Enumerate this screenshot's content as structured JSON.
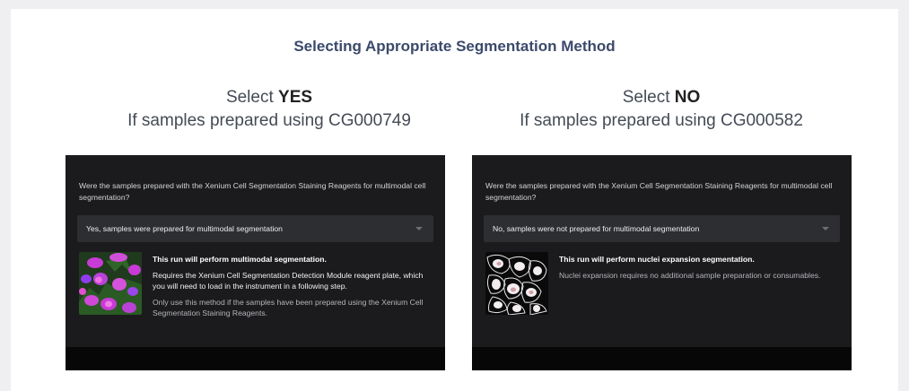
{
  "page": {
    "title": "Selecting Appropriate Segmentation Method"
  },
  "left": {
    "heading_prefix": "Select ",
    "heading_choice": "YES",
    "heading_sub": "If samples prepared using CG000749",
    "question": "Were the samples prepared with the Xenium Cell Segmentation Staining Reagents for multimodal cell segmentation?",
    "select_value": "Yes, samples were prepared for multimodal segmentation",
    "info_title": "This run will perform multimodal segmentation.",
    "info_line1": "Requires the Xenium Cell Segmentation Detection Module reagent plate, which you will need to load in the instrument in a following step.",
    "info_line2": "Only use this method if the samples have been prepared using the Xenium Cell Segmentation Staining Reagents."
  },
  "right": {
    "heading_prefix": "Select ",
    "heading_choice": "NO",
    "heading_sub": "If samples prepared using CG000582",
    "question": "Were the samples prepared with the Xenium Cell Segmentation Staining Reagents for multimodal cell segmentation?",
    "select_value": "No, samples were not prepared for multimodal segmentation",
    "info_title": "This run will perform nuclei expansion segmentation.",
    "info_line1": "Nuclei expansion requires no additional sample preparation or consumables."
  },
  "colors": {
    "title": "#3b4a6b",
    "panel_bg": "#1b1b1d",
    "select_bg": "#2d2e31",
    "multimodal_cells": "#c83bd6",
    "nuclei_cells": "#ffffff"
  },
  "icons": {
    "dropdown": "chevron-down-icon",
    "left_thumb": "multimodal-cells-image",
    "right_thumb": "nuclei-expansion-image"
  }
}
